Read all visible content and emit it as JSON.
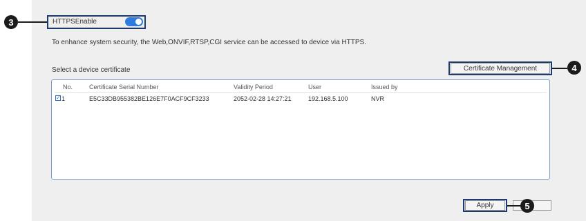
{
  "https": {
    "label": "HTTPSEnable",
    "enabled": true
  },
  "description": "To enhance system security, the Web,ONVIF,RTSP,CGI service can be accessed to device via HTTPS.",
  "select_certificate_label": "Select a device certificate",
  "certificate_management_label": "Certificate Management",
  "table": {
    "columns": [
      "No.",
      "Certificate Serial Number",
      "Validity Period",
      "User",
      "Issued by"
    ],
    "rows": [
      {
        "checked": true,
        "no": "1",
        "serial": "E5C33DB955382BE126E7F0ACF9CF3233",
        "validity": "2052-02-28 14:27:21",
        "user": "192.168.5.100",
        "issued_by": "NVR"
      }
    ]
  },
  "apply_label": "Apply",
  "blank_button_label": "",
  "callouts": [
    "3",
    "4",
    "5"
  ],
  "colors": {
    "accent": "#2f7be0",
    "callout": "#1b1b1b",
    "highlight": "#1f3a6e",
    "background": "#efefef"
  }
}
